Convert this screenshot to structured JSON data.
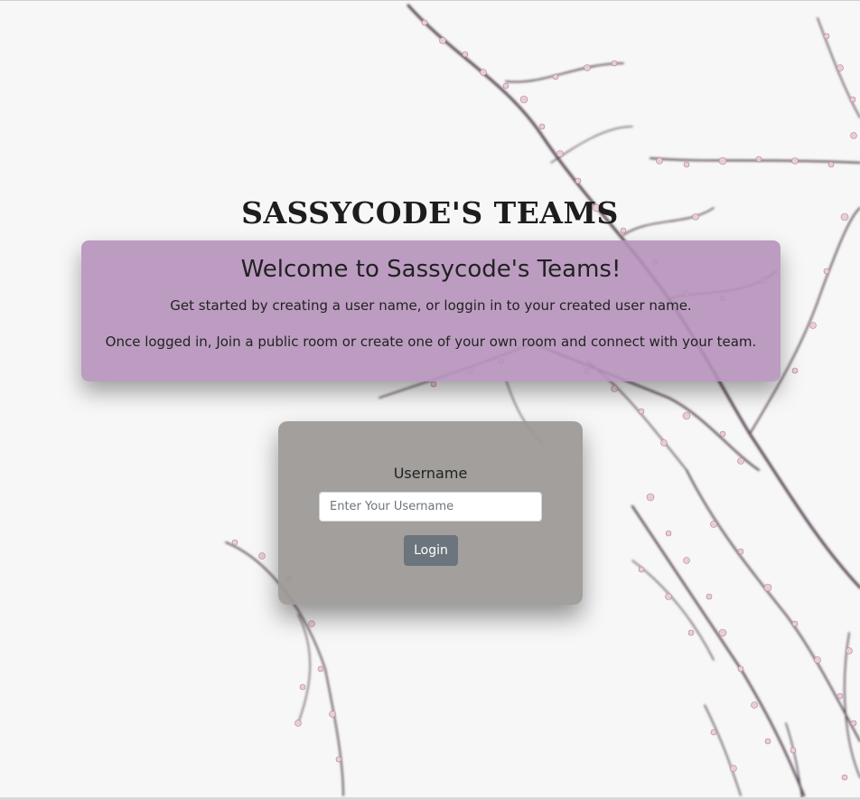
{
  "site_title": "SASSYCODE'S TEAMS",
  "welcome": {
    "heading": "Welcome to Sassycode's Teams!",
    "line1": "Get started by creating a user name, or loggin in to your created user name.",
    "line2": "Once logged in, Join a public room or create one of your own room and connect with your team."
  },
  "login": {
    "label": "Username",
    "placeholder": "Enter Your Username",
    "value": "",
    "button_label": "Login"
  },
  "colors": {
    "welcome_card": "#b491b9",
    "login_card": "#9b9894",
    "login_button": "#6c757d",
    "branch": "#5a4a55",
    "blossom": "#e8cdd6"
  },
  "background_image": "cherry-blossom-branches"
}
